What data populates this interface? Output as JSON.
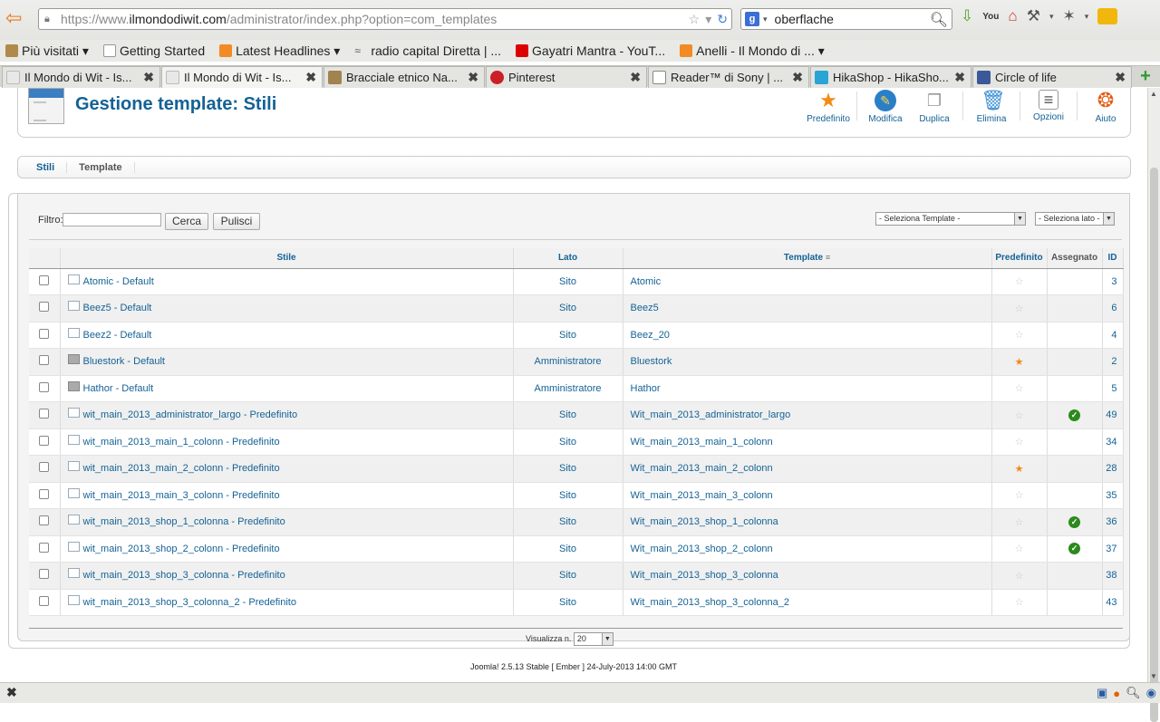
{
  "browser": {
    "url_prefix": "https://www.",
    "url_domain": "ilmondodiwit.com",
    "url_path": "/administrator/index.php?option=com_templates",
    "search_value": "oberflache",
    "bookmarks": [
      {
        "label": "Più visitati ▾",
        "icon": "folder"
      },
      {
        "label": "Getting Started",
        "icon": "blank"
      },
      {
        "label": "Latest Headlines ▾",
        "icon": "rss"
      },
      {
        "label": "radio capital Diretta | ...",
        "icon": "radio"
      },
      {
        "label": "Gayatri Mantra - YouT...",
        "icon": "youtube"
      },
      {
        "label": "Anelli - Il Mondo di ... ▾",
        "icon": "rss"
      }
    ],
    "tabs": [
      {
        "label": "Il Mondo di Wit - Is...",
        "icon": "joomla"
      },
      {
        "label": "Il Mondo di Wit - Is...",
        "icon": "joomla"
      },
      {
        "label": "Bracciale etnico Na...",
        "icon": "bracelet"
      },
      {
        "label": "Pinterest",
        "icon": "pinterest"
      },
      {
        "label": "Reader™ di Sony | ...",
        "icon": "blank"
      },
      {
        "label": "HikaShop - HikaSho...",
        "icon": "hikashop"
      },
      {
        "label": "Circle of life",
        "icon": "facebook"
      }
    ]
  },
  "header": {
    "title": "Gestione template: Stili",
    "toolbar": [
      {
        "label": "Predefinito",
        "icon": "star-icon"
      },
      {
        "label": "Modifica",
        "icon": "edit-icon"
      },
      {
        "label": "Duplica",
        "icon": "duplicate-icon"
      },
      {
        "label": "Elimina",
        "icon": "trash-icon"
      },
      {
        "label": "Opzioni",
        "icon": "options-icon"
      },
      {
        "label": "Aiuto",
        "icon": "help-icon"
      }
    ]
  },
  "submenu": {
    "styles": "Stili",
    "templates": "Template"
  },
  "filter": {
    "label": "Filtro:",
    "value": "",
    "search_button": "Cerca",
    "clear_button": "Pulisci",
    "select_template": "- Seleziona Template -",
    "select_side": "- Seleziona lato -"
  },
  "table": {
    "headers": {
      "style": "Stile",
      "side": "Lato",
      "template": "Template",
      "default": "Predefinito",
      "assigned": "Assegnato",
      "id": "ID"
    },
    "rows": [
      {
        "style": "Atomic - Default",
        "side": "Sito",
        "template": "Atomic",
        "default": false,
        "assigned": false,
        "id": "3",
        "admin": false
      },
      {
        "style": "Beez5 - Default",
        "side": "Sito",
        "template": "Beez5",
        "default": false,
        "assigned": false,
        "id": "6",
        "admin": false
      },
      {
        "style": "Beez2 - Default",
        "side": "Sito",
        "template": "Beez_20",
        "default": false,
        "assigned": false,
        "id": "4",
        "admin": false
      },
      {
        "style": "Bluestork - Default",
        "side": "Amministratore",
        "template": "Bluestork",
        "default": true,
        "assigned": false,
        "id": "2",
        "admin": true
      },
      {
        "style": "Hathor - Default",
        "side": "Amministratore",
        "template": "Hathor",
        "default": false,
        "assigned": false,
        "id": "5",
        "admin": true
      },
      {
        "style": "wit_main_2013_administrator_largo - Predefinito",
        "side": "Sito",
        "template": "Wit_main_2013_administrator_largo",
        "default": false,
        "assigned": true,
        "id": "49",
        "admin": false
      },
      {
        "style": "wit_main_2013_main_1_colonn - Predefinito",
        "side": "Sito",
        "template": "Wit_main_2013_main_1_colonn",
        "default": false,
        "assigned": false,
        "id": "34",
        "admin": false
      },
      {
        "style": "wit_main_2013_main_2_colonn - Predefinito",
        "side": "Sito",
        "template": "Wit_main_2013_main_2_colonn",
        "default": true,
        "assigned": false,
        "id": "28",
        "admin": false
      },
      {
        "style": "wit_main_2013_main_3_colonn - Predefinito",
        "side": "Sito",
        "template": "Wit_main_2013_main_3_colonn",
        "default": false,
        "assigned": false,
        "id": "35",
        "admin": false
      },
      {
        "style": "wit_main_2013_shop_1_colonna - Predefinito",
        "side": "Sito",
        "template": "Wit_main_2013_shop_1_colonna",
        "default": false,
        "assigned": true,
        "id": "36",
        "admin": false
      },
      {
        "style": "wit_main_2013_shop_2_colonn - Predefinito",
        "side": "Sito",
        "template": "Wit_main_2013_shop_2_colonn",
        "default": false,
        "assigned": true,
        "id": "37",
        "admin": false
      },
      {
        "style": "wit_main_2013_shop_3_colonna - Predefinito",
        "side": "Sito",
        "template": "Wit_main_2013_shop_3_colonna",
        "default": false,
        "assigned": false,
        "id": "38",
        "admin": false
      },
      {
        "style": "wit_main_2013_shop_3_colonna_2 - Predefinito",
        "side": "Sito",
        "template": "Wit_main_2013_shop_3_colonna_2",
        "default": false,
        "assigned": false,
        "id": "43",
        "admin": false
      }
    ]
  },
  "pager": {
    "label": "Visualizza n.",
    "value": "20"
  },
  "footer": {
    "text": "Joomla! 2.5.13 Stable [ Ember ] 24-July-2013 14:00 GMT"
  },
  "colors": {
    "link": "#146295",
    "star_active": "#f28c12",
    "check_green": "#2c8a1c"
  }
}
